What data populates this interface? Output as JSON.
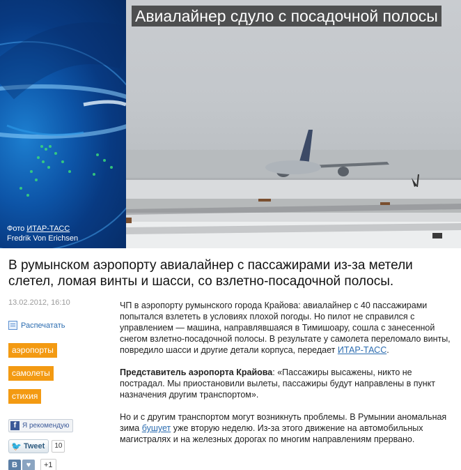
{
  "hero": {
    "title": "Авиалайнер сдуло с посадочной полосы",
    "credit_prefix": "Фото",
    "credit_agency": "ИТАР-ТАСС",
    "credit_author": "Fredrik Von Erichsen"
  },
  "article": {
    "lead": "В румынском аэропорту авиалайнер с пассажирами из-за метели слетел, ломая винты и шасси, со взлетно-посадочной полосы.",
    "date": "13.02.2012, 16:10",
    "print_label": "Распечатать",
    "tags": [
      "аэропорты",
      "самолеты",
      "стихия"
    ],
    "p1_text": "ЧП в аэропорту румынского города Крайова: авиалайнер с 40 пассажирами попытался взлететь в условиях плохой погоды. Но пилот не справился с управлением — машина, направлявшаяся в Тимишоару, сошла с занесенной снегом взлетно-посадочной полосы. В результате у самолета переломало винты, повредило шасси и другие детали корпуса, передает",
    "p1_link": "ИТАР-ТАСС",
    "p1_end": ".",
    "p2_bold": "Представитель аэропорта Крайова",
    "p2_text": ": «Пассажиры высажены, никто не пострадал. Мы приостановили вылеты, пассажиры будут направлены в пункт назначения другим транспортом».",
    "p3_start": "Но и с другим транспортом могут возникнуть проблемы. В Румынии аномальная зима",
    "p3_link": "бушует",
    "p3_end": "уже вторую неделю. Из-за этого движение на автомобильных магистралях и на железных дорогах по многим направлениям прервано."
  },
  "social": {
    "fb_icon": "f",
    "fb_label": "Я рекомендую",
    "tweet_label": "Tweet",
    "tweet_count": "10",
    "vk_icon": "B",
    "vk_like_icon": "♥",
    "plus_one": "+1"
  },
  "colors": {
    "tag_bg": "#f39a12",
    "link": "#2b6cb0",
    "globe_blue": "#0d55a8"
  }
}
